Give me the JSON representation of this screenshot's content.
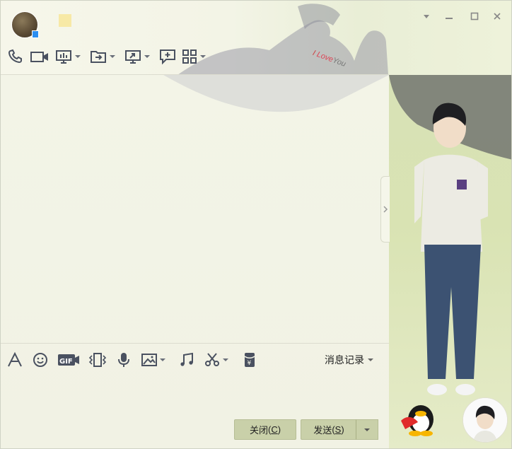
{
  "window": {
    "controls": {
      "menu_icon": "chevron-down-icon",
      "minimize_icon": "minimize-icon",
      "maximize_icon": "maximize-icon",
      "close_icon": "close-icon"
    }
  },
  "decor": {
    "heart_text_i": "I",
    "heart_text_love": "Love",
    "heart_text_you": "You"
  },
  "toolbar_top": [
    {
      "icon": "phone-icon",
      "dropdown": false
    },
    {
      "icon": "video-camera-icon",
      "dropdown": false
    },
    {
      "icon": "presentation-icon",
      "dropdown": true
    },
    {
      "icon": "file-transfer-icon",
      "dropdown": true
    },
    {
      "icon": "screen-share-icon",
      "dropdown": true
    },
    {
      "icon": "add-message-icon",
      "dropdown": false
    },
    {
      "icon": "apps-grid-icon",
      "dropdown": true
    }
  ],
  "toolbar_bottom": [
    {
      "icon": "font-icon"
    },
    {
      "icon": "emoji-icon"
    },
    {
      "icon": "gif-icon"
    },
    {
      "icon": "shake-window-icon"
    },
    {
      "icon": "microphone-icon"
    },
    {
      "icon": "image-icon"
    },
    {
      "icon": "music-icon"
    },
    {
      "icon": "scissors-icon"
    },
    {
      "icon": "red-packet-icon"
    }
  ],
  "history": {
    "label": "消息记录"
  },
  "buttons": {
    "close_label": "关闭",
    "close_key": "C",
    "send_label": "发送",
    "send_key": "S"
  },
  "colors": {
    "background": "#f2f3e6",
    "right_panel": "#d9e3b3",
    "button": "#c9d0a9",
    "icon": "#4a5160"
  }
}
